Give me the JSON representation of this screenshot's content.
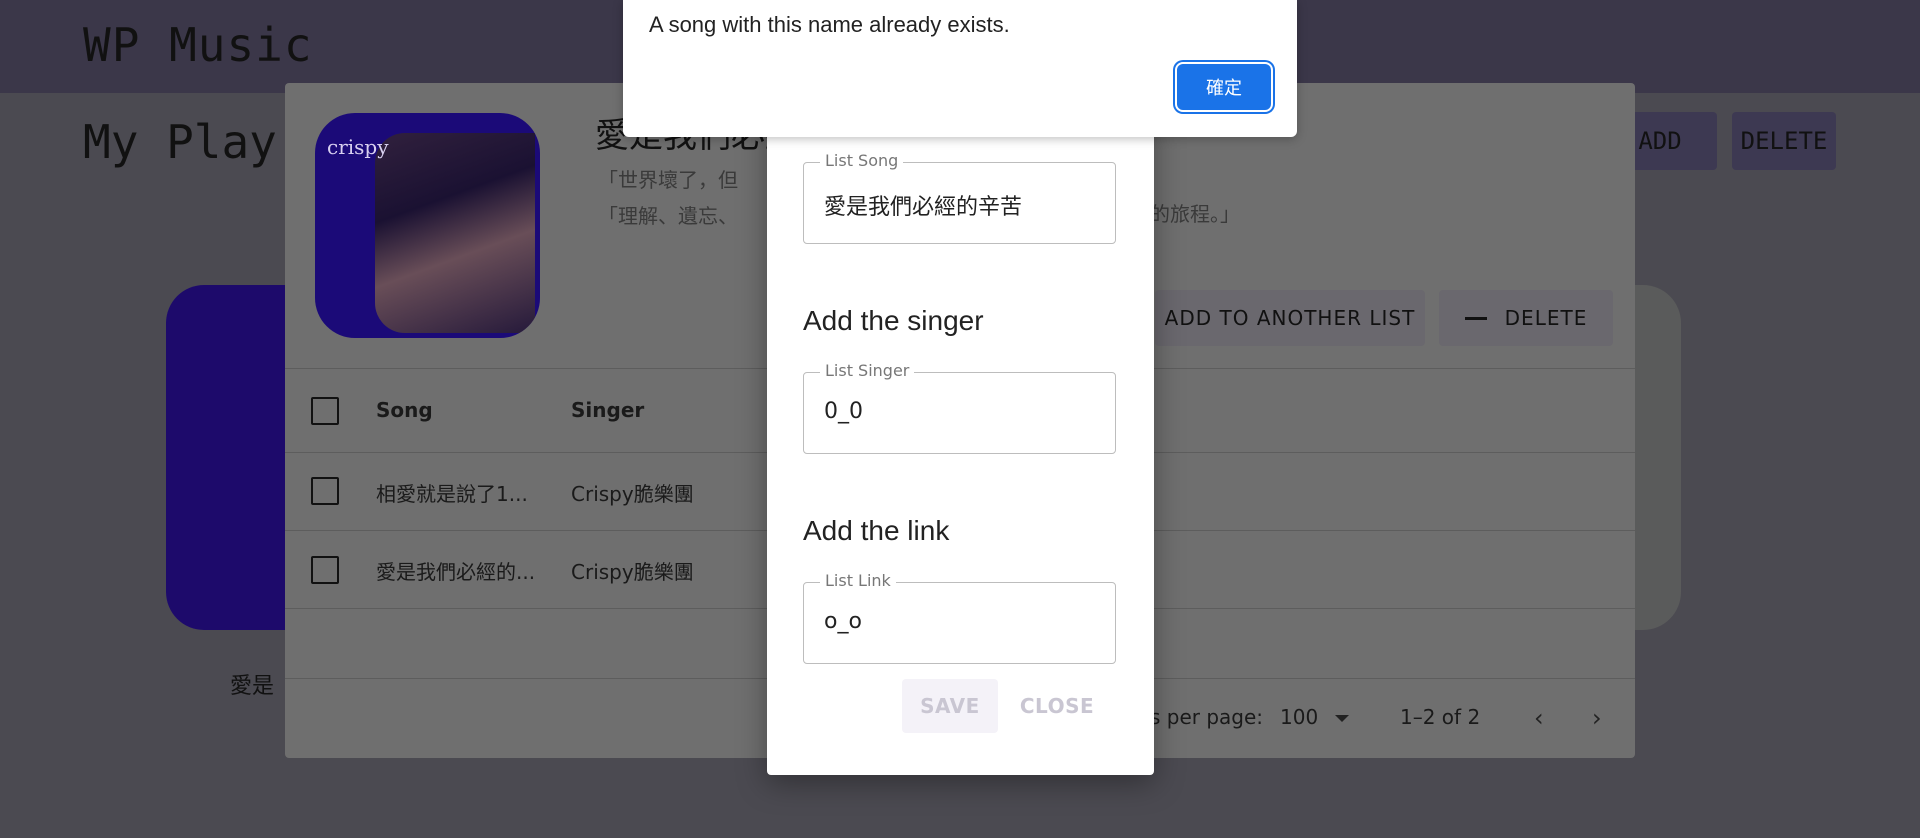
{
  "app": {
    "title": "WP Music",
    "page_heading": "My Play"
  },
  "page_buttons": {
    "add": "ADD",
    "delete": "DELETE"
  },
  "background_card": {
    "caption": "愛是"
  },
  "playlist_dialog": {
    "title": "愛是我們必經",
    "description_line1": "「世界壞了，但",
    "description_line2": "「理解、遺忘、",
    "description_line2_end": "愛的旅程。」",
    "cover_brand": "crispy",
    "add_to_another_list": "ADD TO ANOTHER LIST",
    "delete": "DELETE",
    "table": {
      "headers": [
        "Song",
        "Singer"
      ],
      "rows": [
        {
          "song": "相愛就是說了1...",
          "singer": "Crispy脆樂團"
        },
        {
          "song": "愛是我們必經的...",
          "singer": "Crispy脆樂團"
        }
      ]
    },
    "pagination": {
      "rows_per_page_label": "s per page:",
      "rows_per_page_value": "100",
      "range": "1–2 of 2"
    }
  },
  "edit_dialog": {
    "song_field": {
      "label": "List Song",
      "value": "愛是我們必經的辛苦"
    },
    "singer_section": "Add the singer",
    "singer_field": {
      "label": "List Singer",
      "value": "0_0"
    },
    "link_section": "Add the link",
    "link_field": {
      "label": "List Link",
      "value": "o_o"
    },
    "save": "SAVE",
    "close": "CLOSE"
  },
  "alert": {
    "message": "A song with this name already exists.",
    "ok": "確定"
  },
  "colors": {
    "accent": "#1a73e8",
    "appbar": "#3b3749"
  }
}
